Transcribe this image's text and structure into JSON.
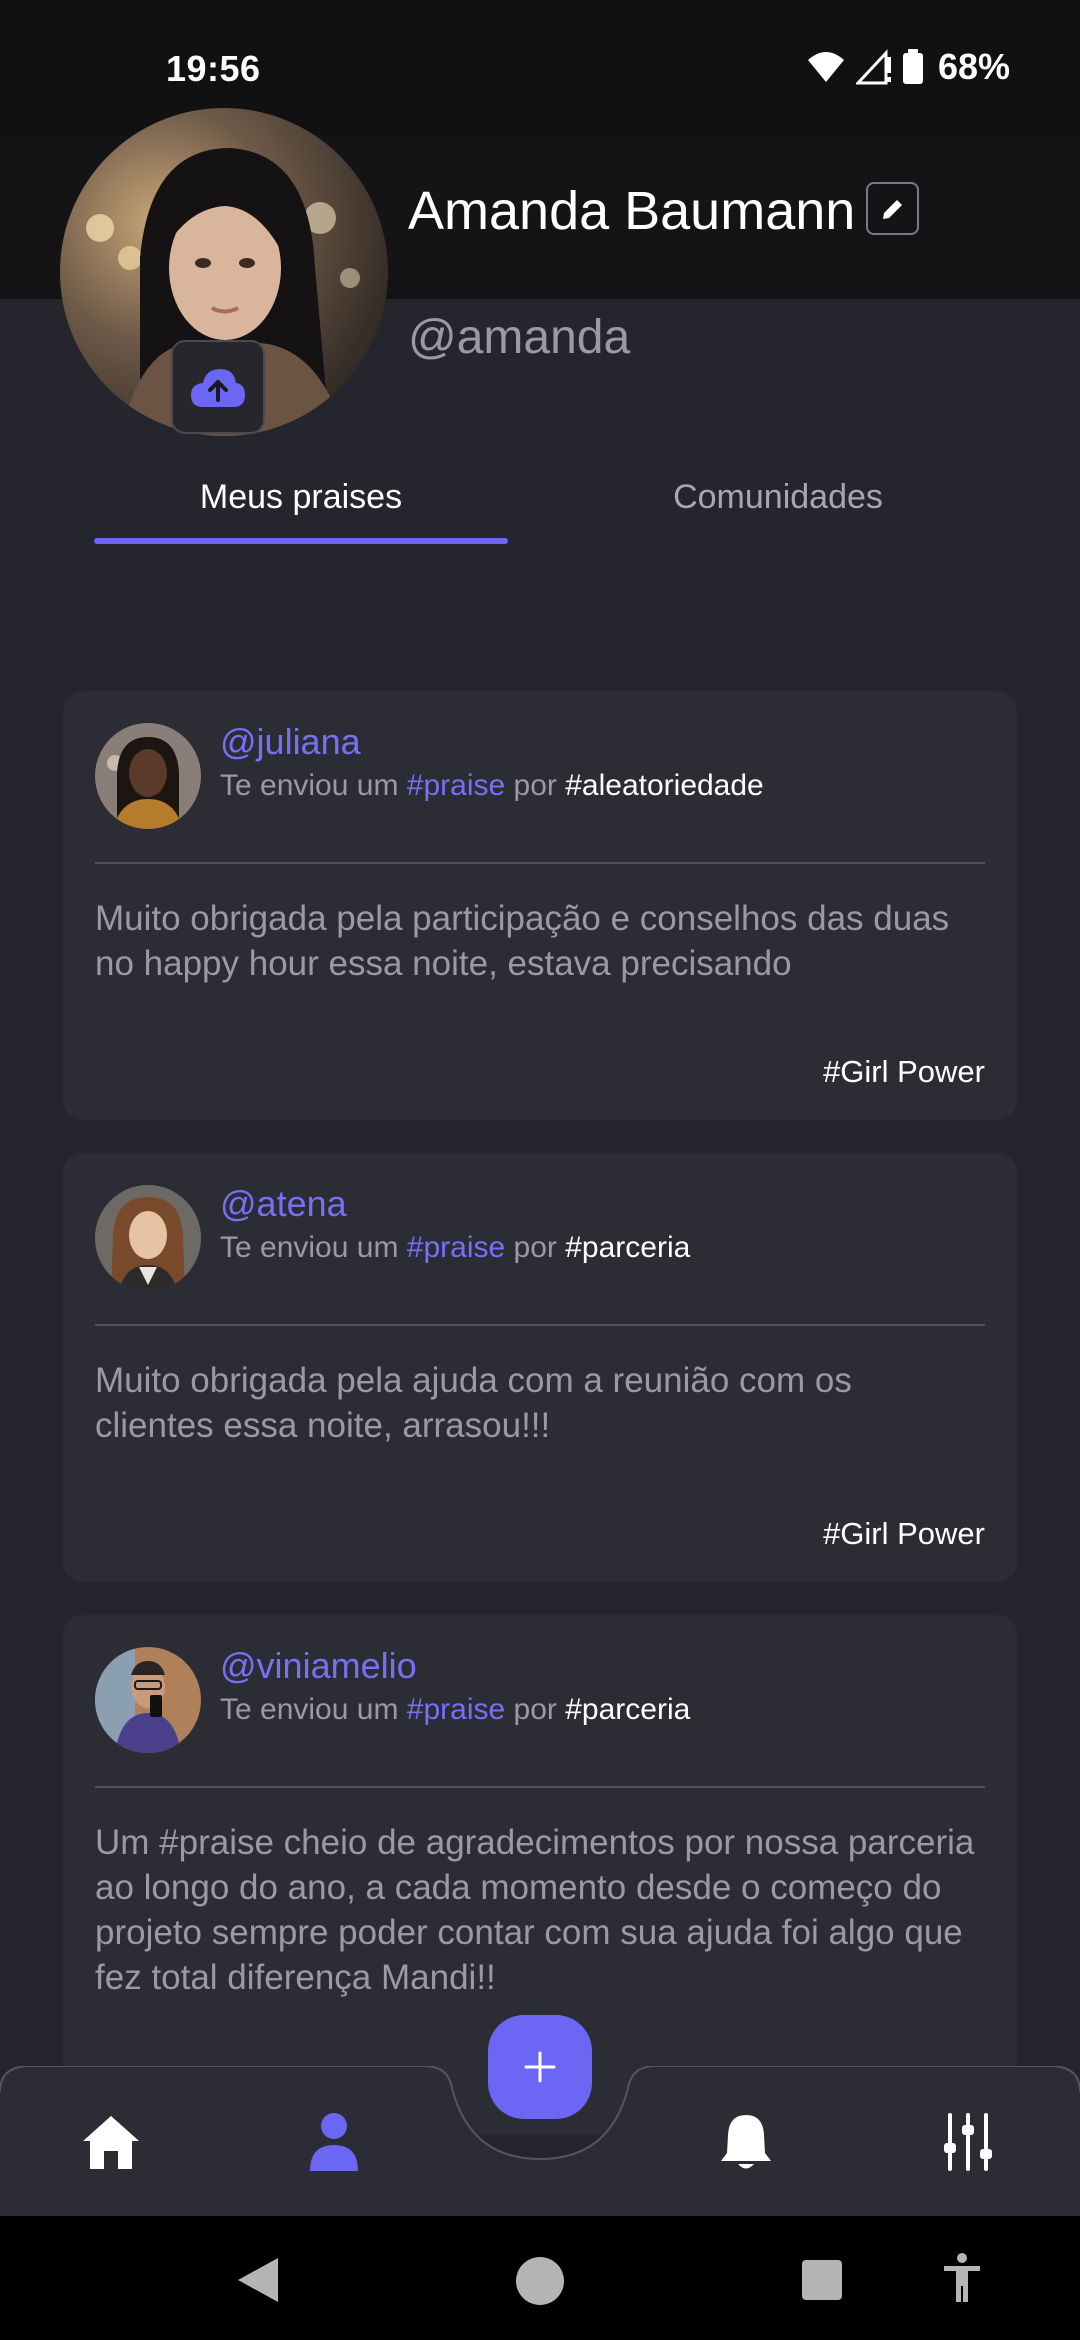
{
  "status_bar": {
    "time": "19:56",
    "battery": "68%"
  },
  "profile": {
    "name": "Amanda Baumann",
    "handle": "@amanda"
  },
  "tabs": [
    {
      "label": "Meus praises",
      "active": true
    },
    {
      "label": "Comunidades",
      "active": false
    }
  ],
  "cards": [
    {
      "user": "@juliana",
      "sub_prefix": "Te enviou um",
      "sub_praise": "#praise",
      "sub_por": "por",
      "sub_tag": "#aleatoriedade",
      "message": "Muito obrigada pela participação e conselhos das duas no happy hour essa noite, estava precisando",
      "badge": "#Girl Power"
    },
    {
      "user": "@atena",
      "sub_prefix": "Te enviou um",
      "sub_praise": "#praise",
      "sub_por": "por",
      "sub_tag": "#parceria",
      "message": "Muito obrigada pela ajuda com a reunião com os clientes essa noite, arrasou!!!",
      "badge": "#Girl Power"
    },
    {
      "user": "@viniamelio",
      "sub_prefix": "Te enviou um",
      "sub_praise": "#praise",
      "sub_por": "por",
      "sub_tag": "#parceria",
      "message": "Um  #praise cheio de agradecimentos por nossa parceria ao longo do ano, a cada momento desde o começo do projeto sempre poder contar com sua ajuda foi algo que fez total diferença Mandi!!",
      "badge": ""
    }
  ],
  "bottom_nav": {
    "items": [
      "home-icon",
      "profile-icon",
      "add-icon",
      "bell-icon",
      "sliders-icon"
    ],
    "active": "profile-icon"
  },
  "colors": {
    "accent": "#6b66f3",
    "background": "#25252d",
    "card": "#2c2c34"
  }
}
